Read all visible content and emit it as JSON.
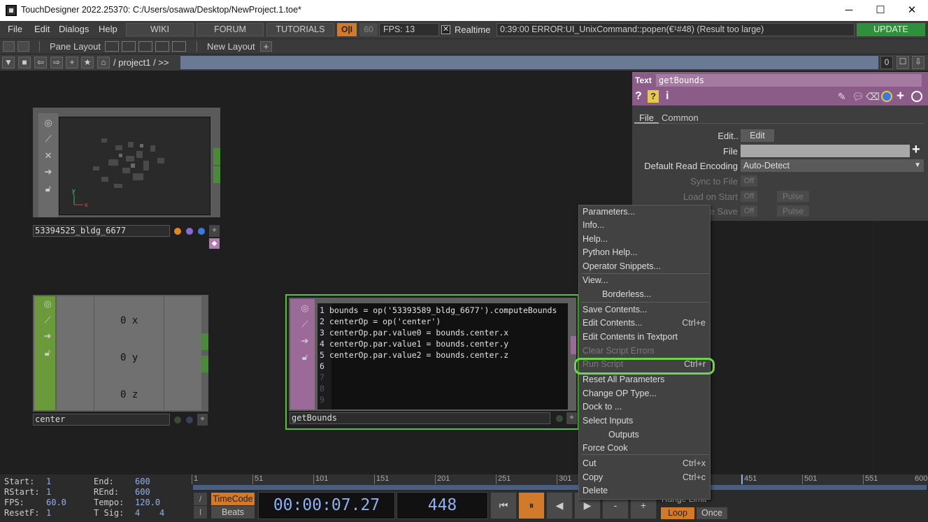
{
  "window": {
    "title": "TouchDesigner 2022.25370: C:/Users/osawa/Desktop/NewProject.1.toe*",
    "minimize": "─",
    "maximize": "☐",
    "close": "✕"
  },
  "menubar": {
    "items": [
      "File",
      "Edit",
      "Dialogs",
      "Help"
    ],
    "buttons": [
      "WIKI",
      "FORUM",
      "TUTORIALS"
    ],
    "oi": "O|I",
    "fps_cap": "60",
    "fps_label": "FPS:  13",
    "realtime_check": "✕",
    "realtime": "Realtime",
    "error": "0:39:00 ERROR:UI_UnixCommand::popen(€¹#48) (Result too large)",
    "update": "UPDATE"
  },
  "panebar": {
    "pane_layout": "Pane Layout",
    "new_layout": "New Layout",
    "plus": "+"
  },
  "pathbar": {
    "path": "/ project1 / >>",
    "counter": "0"
  },
  "nodes": {
    "geo": {
      "name": "53394525_bldg_6677",
      "axis_y": "y",
      "axis_x": "x"
    },
    "center": {
      "name": "center",
      "values": [
        "0 x",
        "0 y",
        "0 z"
      ]
    },
    "text": {
      "name": "getBounds",
      "lines": [
        {
          "num": "1",
          "code": "bounds = op('53393589_bldg_6677').computeBounds"
        },
        {
          "num": "2",
          "code": "centerOp = op('center')"
        },
        {
          "num": "3",
          "code": "centerOp.par.value0 = bounds.center.x"
        },
        {
          "num": "4",
          "code": "centerOp.par.value1 = bounds.center.y"
        },
        {
          "num": "5",
          "code": "centerOp.par.value2 = bounds.center.z"
        },
        {
          "num": "6",
          "code": ""
        },
        {
          "num": "7",
          "code": ""
        },
        {
          "num": "8",
          "code": ""
        },
        {
          "num": "9",
          "code": ""
        }
      ]
    }
  },
  "params": {
    "optype": "Text",
    "opname": "getBounds",
    "tabs": [
      "File",
      "Common"
    ],
    "edit_label": "Edit..",
    "edit_button": "Edit",
    "file_label": "File",
    "encoding_label": "Default Read Encoding",
    "encoding_value": "Auto-Detect",
    "sync_label": "Sync to File",
    "load_label": "Load on Start",
    "save_label": "e Save",
    "off": "Off",
    "pulse": "Pulse"
  },
  "context_menu": {
    "items": [
      {
        "label": "Parameters...",
        "shortcut": ""
      },
      {
        "label": "Info...",
        "shortcut": ""
      },
      {
        "label": "Help...",
        "shortcut": ""
      },
      {
        "label": "Python Help...",
        "shortcut": ""
      },
      {
        "label": "Operator Snippets...",
        "shortcut": ""
      },
      {
        "label": "View...",
        "shortcut": ""
      },
      {
        "label": "Borderless...",
        "shortcut": ""
      },
      {
        "label": "Save Contents...",
        "shortcut": ""
      },
      {
        "label": "Edit Contents...",
        "shortcut": "Ctrl+e"
      },
      {
        "label": "Edit Contents in Textport",
        "shortcut": ""
      },
      {
        "label": "Clear Script Errors",
        "shortcut": ""
      },
      {
        "label": "Run Script",
        "shortcut": "Ctrl+r"
      },
      {
        "label": "Reset All Parameters",
        "shortcut": ""
      },
      {
        "label": "Change OP Type...",
        "shortcut": ""
      },
      {
        "label": "Dock to ...",
        "shortcut": ""
      },
      {
        "label": "Select Inputs",
        "shortcut": ""
      },
      {
        "label": "Outputs",
        "shortcut": ""
      },
      {
        "label": "Force Cook",
        "shortcut": ""
      },
      {
        "label": "Cut",
        "shortcut": "Ctrl+x"
      },
      {
        "label": "Copy",
        "shortcut": "Ctrl+c"
      },
      {
        "label": "Delete",
        "shortcut": ""
      }
    ]
  },
  "timeline": {
    "start_label": "Start:",
    "start": "1",
    "end_label": "End:",
    "end": "600",
    "rstart_label": "RStart:",
    "rstart": "1",
    "rend_label": "REnd:",
    "rend": "600",
    "fps_label": "FPS:",
    "fps": "60.0",
    "tempo_label": "Tempo:",
    "tempo": "120.0",
    "resetf_label": "ResetF:",
    "resetf": "1",
    "tsig_label": "T Sig:",
    "tsig_a": "4",
    "tsig_b": "4",
    "ticks": [
      "1",
      "51",
      "101",
      "151",
      "201",
      "251",
      "301",
      "451",
      "501",
      "551",
      "600"
    ],
    "timecode": "TimeCode",
    "beats": "Beats",
    "time": "00:00:07.27",
    "frame": "448",
    "range_limit": "Range Limit",
    "loop": "Loop",
    "once": "Once",
    "minus": "-",
    "plus": "+"
  }
}
